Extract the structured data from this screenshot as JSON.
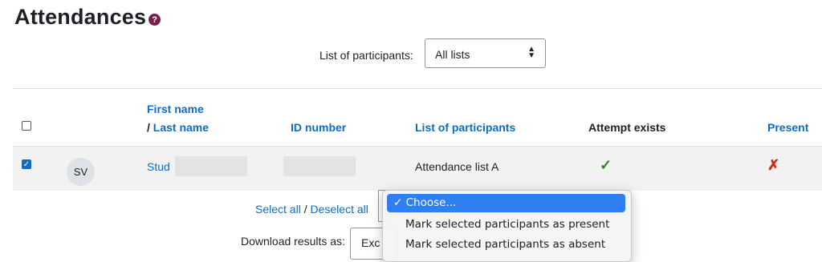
{
  "page": {
    "title": "Attendances",
    "help_icon": "question-circle-icon"
  },
  "filter": {
    "label": "List of participants:",
    "selected": "All lists"
  },
  "table": {
    "headers": {
      "first_name": "First name",
      "last_name_prefix": "/ ",
      "last_name": "Last name",
      "id_number": "ID number",
      "list_of_participants": "List of participants",
      "attempt_exists": "Attempt exists",
      "present": "Present"
    },
    "rows": [
      {
        "checked": true,
        "avatar_initials": "SV",
        "name": "Stud",
        "list": "Attendance list A",
        "attempt_exists": "✓",
        "present": "✗"
      }
    ]
  },
  "bulk": {
    "select_all": "Select all",
    "separator": "/",
    "deselect_all": "Deselect all"
  },
  "download": {
    "label": "Download results as:",
    "selected": "Exc"
  },
  "action_dropdown": {
    "options": [
      "✓ Choose...",
      "Mark selected participants as present",
      "Mark selected participants as absent"
    ],
    "active_index": 0,
    "active_color": "#2f7ff2"
  },
  "colors": {
    "link": "#0f6cbf",
    "check": "#2b8a1d",
    "cross": "#d22b12",
    "help_icon": "#7b1e4c"
  }
}
